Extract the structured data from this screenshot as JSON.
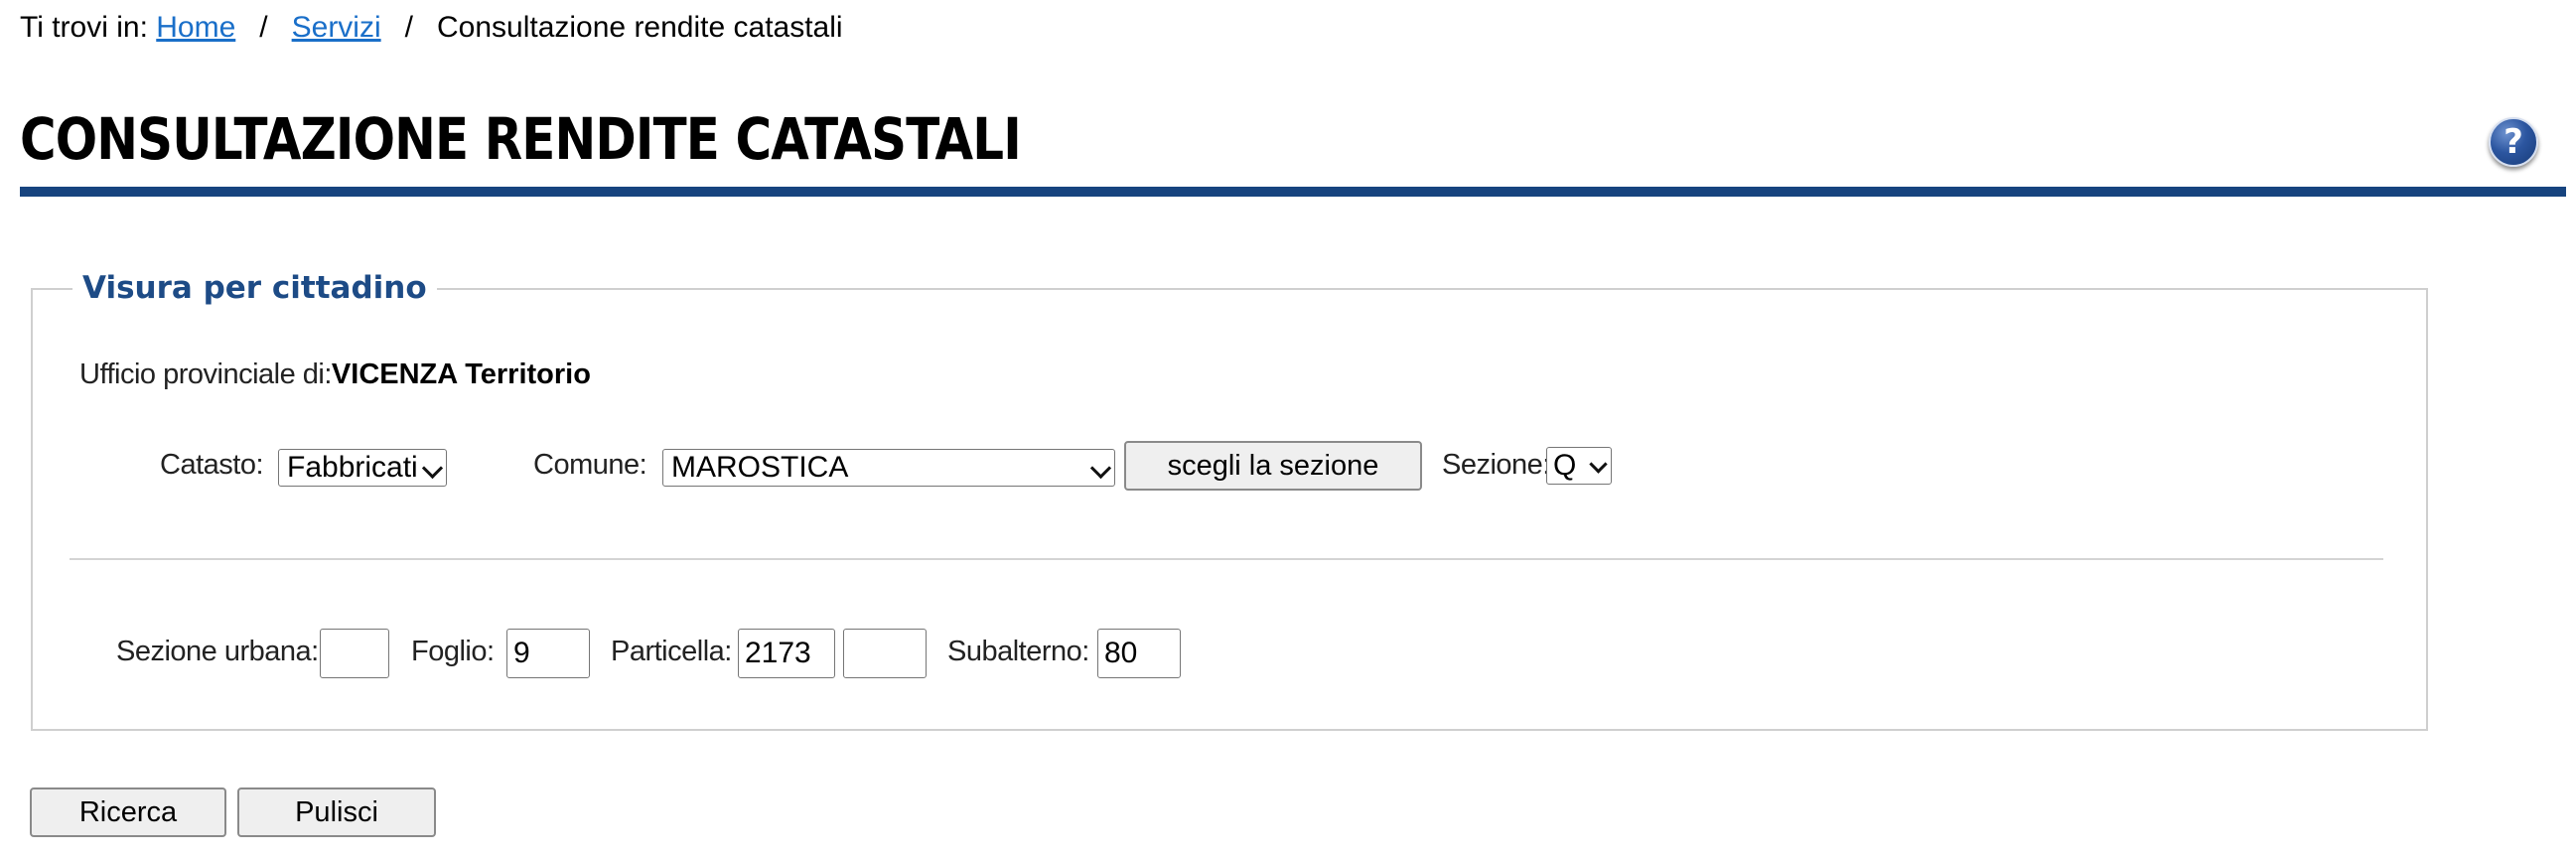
{
  "breadcrumb": {
    "prefix": "Ti trovi in:",
    "items": [
      {
        "label": "Home"
      },
      {
        "label": "Servizi"
      },
      {
        "label": "Consultazione rendite catastali"
      }
    ],
    "separator": "/"
  },
  "page": {
    "title": "CONSULTAZIONE RENDITE CATASTALI",
    "help_icon": "?"
  },
  "form": {
    "legend": "Visura per cittadino",
    "ufficio_label": "Ufficio provinciale di:",
    "ufficio_value": "VICENZA Territorio",
    "catasto": {
      "label": "Catasto:",
      "value": "Fabbricati"
    },
    "comune": {
      "label": "Comune:",
      "value": "MAROSTICA"
    },
    "scegli_button": "scegli la sezione",
    "sezione": {
      "label": "Sezione:",
      "value": "Q"
    },
    "sezione_urbana": {
      "label": "Sezione urbana:",
      "value": ""
    },
    "foglio": {
      "label": "Foglio:",
      "value": "9"
    },
    "particella": {
      "label": "Particella:",
      "value": "2173",
      "value2": ""
    },
    "subalterno": {
      "label": "Subalterno:",
      "value": "80"
    }
  },
  "actions": {
    "ricerca": "Ricerca",
    "pulisci": "Pulisci"
  },
  "colors": {
    "accent": "#17447f",
    "legend": "#1d4b86",
    "link": "#1a6fc9"
  }
}
